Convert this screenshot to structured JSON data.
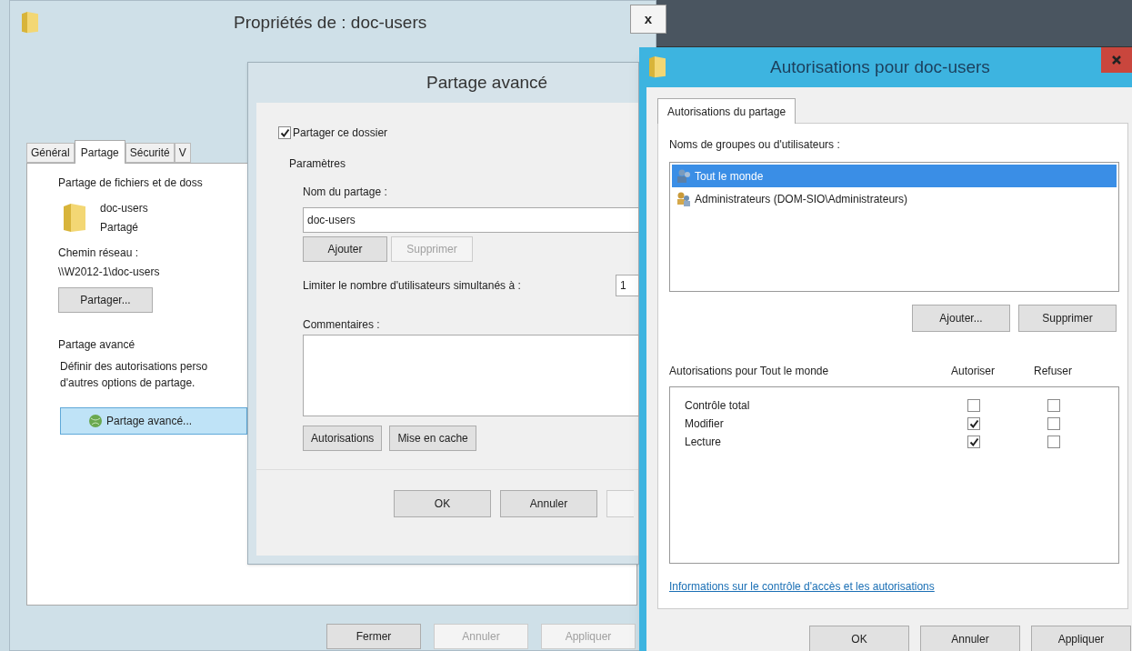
{
  "properties_window": {
    "title": "Propriétés de : doc-users",
    "close": "x",
    "tabs": [
      {
        "label": "Général",
        "selected": false
      },
      {
        "label": "Partage",
        "selected": true
      },
      {
        "label": "Sécurité",
        "selected": false
      },
      {
        "label": "V",
        "selected": false
      }
    ],
    "sharing_heading": "Partage de fichiers et de doss",
    "folder_name": "doc-users",
    "folder_status": "Partagé",
    "path_label": "Chemin réseau :",
    "path": "\\\\W2012-1\\doc-users",
    "share_button": "Partager...",
    "advanced_heading": "Partage avancé",
    "advanced_description": [
      "Définir des autorisations perso",
      "d'autres options de partage."
    ],
    "advanced_button": "Partage avancé...",
    "buttons": [
      {
        "label": "Fermer",
        "disabled": false
      },
      {
        "label": "Annuler",
        "disabled": true
      },
      {
        "label": "Appliquer",
        "disabled": true
      }
    ]
  },
  "advanced_sharing_window": {
    "title": "Partage avancé",
    "share_checkbox": {
      "label": "Partager ce dossier",
      "checked": true
    },
    "settings_heading": "Paramètres",
    "share_name_label": "Nom du partage :",
    "share_name": "doc-users",
    "name_buttons": [
      {
        "label": "Ajouter",
        "disabled": false
      },
      {
        "label": "Supprimer",
        "disabled": true
      }
    ],
    "limit_label": "Limiter le nombre d'utilisateurs simultanés à :",
    "limit_value": "1",
    "comments_label": "Commentaires :",
    "option_buttons": [
      "Autorisations",
      "Mise en cache"
    ],
    "buttons": [
      "OK",
      "Annuler"
    ]
  },
  "permissions_window": {
    "title": "Autorisations pour doc-users",
    "tabs": [
      {
        "label": "Autorisations du partage",
        "selected": true
      }
    ],
    "groups_label": "Noms de groupes ou d'utilisateurs :",
    "groups": [
      {
        "name": "Tout le monde",
        "kind": "everyone",
        "selected": true
      },
      {
        "name": "Administrateurs (DOM-SIO\\Administrateurs)",
        "kind": "admins",
        "selected": false
      }
    ],
    "group_buttons": [
      "Ajouter...",
      "Supprimer"
    ],
    "permissions_label": "Autorisations pour Tout le monde",
    "columns": [
      "Autoriser",
      "Refuser"
    ],
    "permissions": [
      {
        "name": "Contrôle total",
        "allow": false,
        "deny": false
      },
      {
        "name": "Modifier",
        "allow": true,
        "deny": false
      },
      {
        "name": "Lecture",
        "allow": true,
        "deny": false
      }
    ],
    "link": "Informations sur le contrôle d'accès et les autorisations",
    "buttons": [
      "OK",
      "Annuler",
      "Appliquer"
    ]
  }
}
